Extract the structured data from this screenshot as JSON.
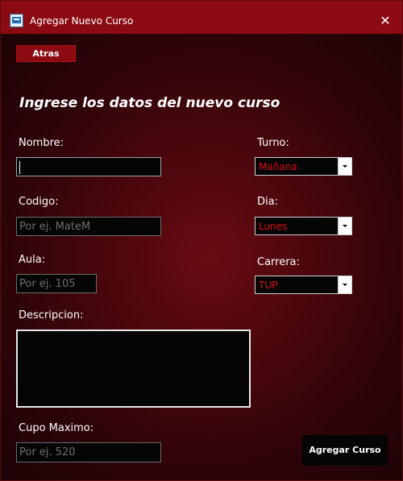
{
  "window": {
    "title": "Agregar Nuevo Curso",
    "app_icon": "app-form-icon",
    "close_icon": "close-icon",
    "close_glyph": "✕"
  },
  "toolbar": {
    "back_label": "Atras"
  },
  "form": {
    "heading": "Ingrese los datos del nuevo curso",
    "nombre": {
      "label": "Nombre:",
      "value": "",
      "placeholder": ""
    },
    "codigo": {
      "label": "Codigo:",
      "value": "",
      "placeholder": "Por ej. MateM"
    },
    "aula": {
      "label": "Aula:",
      "value": "",
      "placeholder": "Por ej. 105"
    },
    "descripcion": {
      "label": "Descripcion:",
      "value": ""
    },
    "cupo": {
      "label": "Cupo Maximo:",
      "value": "",
      "placeholder": "Por ej. 520"
    },
    "turno": {
      "label": "Turno:",
      "selected": "Mañana"
    },
    "dia": {
      "label": "Dia:",
      "selected": "Lunes"
    },
    "carrera": {
      "label": "Carrera:",
      "selected": "TUP"
    },
    "submit_label": "Agregar Curso"
  },
  "colors": {
    "titlebar": "#8c0a12",
    "accent_red_text": "#e00a14",
    "field_background": "#050505"
  }
}
